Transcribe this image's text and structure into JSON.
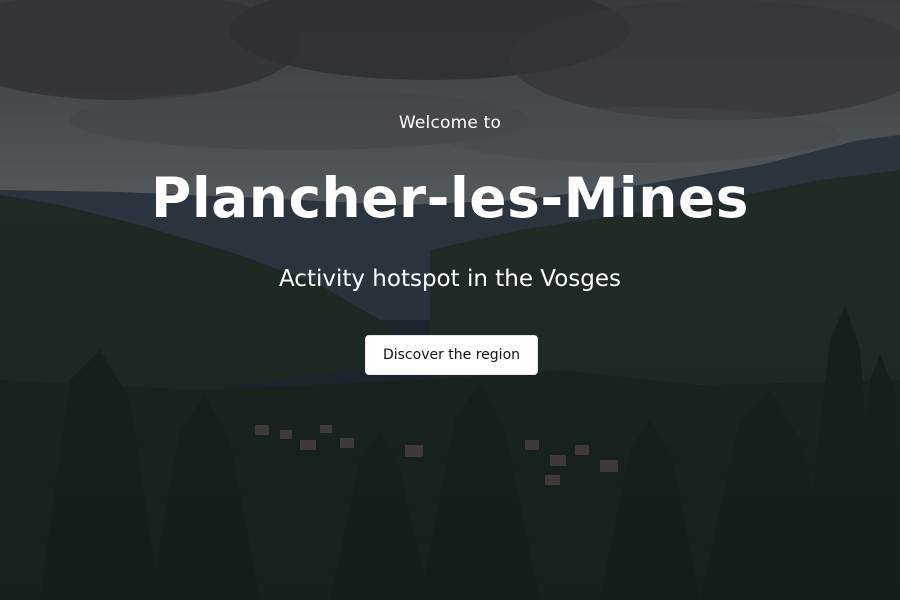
{
  "hero": {
    "eyebrow": "Welcome to",
    "title": "Plancher-les-Mines",
    "tagline": "Activity hotspot in the Vosges",
    "cta_label": "Discover the region",
    "background": "mountain-valley-landscape-photo"
  },
  "colors": {
    "overlay_text": "#ffffff",
    "button_bg": "#ffffff",
    "button_text": "#111111"
  }
}
